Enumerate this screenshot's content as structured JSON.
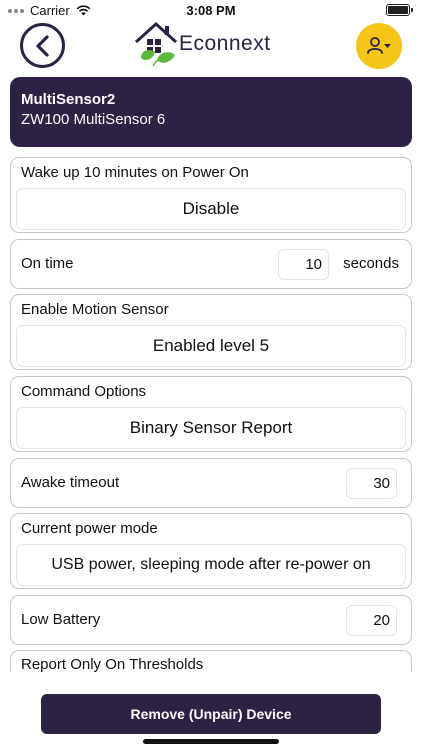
{
  "status_bar": {
    "carrier": "Carrier",
    "time": "3:08 PM"
  },
  "header": {
    "brand": "Econnext"
  },
  "device": {
    "name": "MultiSensor2",
    "model": "ZW100 MultiSensor 6"
  },
  "settings": {
    "wake_up": {
      "label": "Wake up 10 minutes on Power On",
      "value": "Disable"
    },
    "on_time": {
      "label": "On time",
      "value": "10",
      "unit": "seconds"
    },
    "motion": {
      "label": "Enable Motion Sensor",
      "value": "Enabled level 5"
    },
    "command": {
      "label": "Command Options",
      "value": "Binary Sensor Report"
    },
    "awake_timeout": {
      "label": "Awake timeout",
      "value": "30"
    },
    "power_mode": {
      "label": "Current power mode",
      "value": "USB power, sleeping mode after re-power on"
    },
    "low_battery": {
      "label": "Low Battery",
      "value": "20"
    },
    "report_thresholds": {
      "label": "Report Only On Thresholds"
    }
  },
  "actions": {
    "remove_label": "Remove (Unpair) Device"
  },
  "colors": {
    "primary": "#2d2244",
    "accent": "#f5c518",
    "leaf": "#5cb83a"
  },
  "icons": {
    "back": "chevron-left-icon",
    "user": "user-menu-icon",
    "wifi": "wifi-icon",
    "battery": "battery-icon",
    "logo": "house-leaf-logo"
  }
}
